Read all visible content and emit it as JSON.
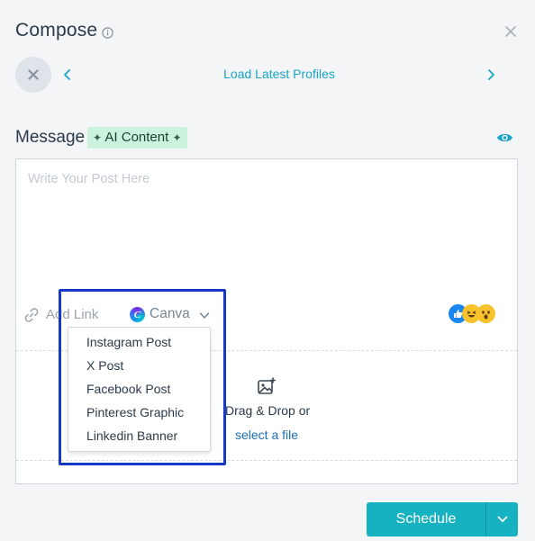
{
  "header": {
    "title": "Compose"
  },
  "profiles": {
    "load_label": "Load Latest Profiles"
  },
  "message": {
    "label": "Message",
    "ai_badge_label": "AI Content",
    "placeholder": "Write Your Post Here"
  },
  "toolbar": {
    "add_link_label": "Add Link",
    "canva_label": "Canva",
    "canva_logo_letter": "C"
  },
  "canva_menu": {
    "items": [
      "Instagram Post",
      "X Post",
      "Facebook Post",
      "Pinterest Graphic",
      "Linkedin Banner"
    ]
  },
  "dropzone": {
    "drag_text": "Drag & Drop or",
    "select_file_label": "select a file"
  },
  "footer": {
    "schedule_label": "Schedule"
  },
  "colors": {
    "accent": "#17b2c2",
    "link": "#1aa3c8",
    "highlight": "#1538c7",
    "ai_badge_bg": "#c9f3dc"
  },
  "icons": [
    "info-icon",
    "close-icon",
    "remove-profile-icon",
    "chevron-left-icon",
    "chevron-right-icon",
    "eye-icon",
    "link-icon",
    "canva-logo-icon",
    "chevron-down-icon",
    "emoji-reactions-icon",
    "image-add-icon",
    "caret-down-icon"
  ]
}
